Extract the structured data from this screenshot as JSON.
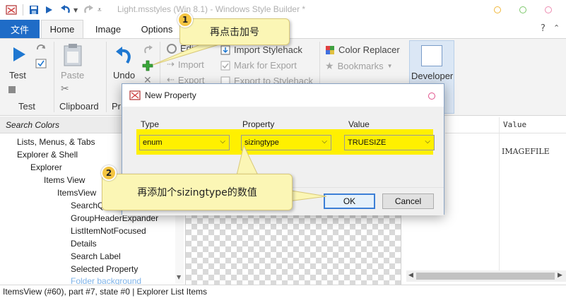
{
  "window": {
    "title": "Light.msstyles (Win 8.1) - Windows Style Builder *",
    "colors": {
      "accent": "#1f6cc7",
      "highlight": "#fff000",
      "callout": "#fbf6b5",
      "badge": "#f4c542"
    }
  },
  "quick_access": {
    "save_icon": "save-icon",
    "run_icon": "play-icon",
    "undo_icon": "undo-icon",
    "redo_icon": "redo-icon",
    "more_icon": "customize-icon"
  },
  "tabs": {
    "file": "文件",
    "items": [
      {
        "label": "Home"
      },
      {
        "label": "Image"
      },
      {
        "label": "Options"
      }
    ],
    "help": "?"
  },
  "ribbon": {
    "test_label": "Test",
    "test_group": "Test",
    "paste_label": "Paste",
    "clipboard_group": "Clipboard",
    "undo_label": "Undo",
    "undo_group_partial": "Pr",
    "edit_partial": "Edi",
    "import_label": "Import",
    "export_partial": "Export",
    "import_stylehack": "Import Stylehack",
    "mark_for_export": "Mark for Export",
    "export_to_stylehack": "Export to Stylehack",
    "color_replacer": "Color Replacer",
    "bookmarks": "Bookmarks",
    "developer": "Developer"
  },
  "left_pane": {
    "search_placeholder": "Search Colors",
    "tree": [
      {
        "label": "Lists, Menus, & Tabs"
      },
      {
        "label": "Explorer & Shell"
      },
      {
        "label": "Explorer"
      },
      {
        "label": "Items View"
      },
      {
        "label": "ItemsView"
      },
      {
        "label": "SearchQu"
      },
      {
        "label": "GroupHeaderExpander"
      },
      {
        "label": "ListItemNotFocused"
      },
      {
        "label": "Details"
      },
      {
        "label": "Search Label"
      },
      {
        "label": "Selected Property"
      },
      {
        "label": "Folder background"
      }
    ]
  },
  "right_pane": {
    "value_header": "Value",
    "value_row": "IMAGEFILE"
  },
  "status": {
    "text": "ItemsView (#60),  part #7,  state #0  |  Explorer List Items"
  },
  "dialog": {
    "title": "New Property",
    "type_label": "Type",
    "type_value": "enum",
    "property_label": "Property",
    "property_value": "sizingtype",
    "value_label": "Value",
    "value_value": "TRUESIZE",
    "ok": "OK",
    "cancel": "Cancel"
  },
  "callouts": [
    {
      "number": "1",
      "text": "再点击加号"
    },
    {
      "number": "2",
      "text": "再添加个sizingtype的数值"
    }
  ]
}
